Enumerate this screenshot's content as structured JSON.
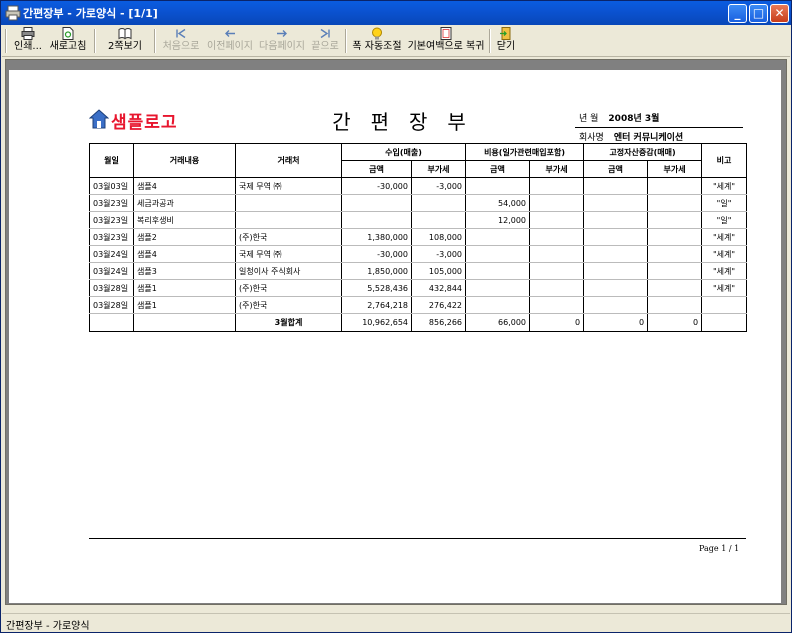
{
  "window": {
    "title": "간편장부 - 가로양식 - [1/1]",
    "min_label": "_",
    "max_label": "□",
    "close_label": "✕"
  },
  "toolbar": {
    "print": "인쇄...",
    "refresh": "새로고침",
    "two_page": "2쪽보기",
    "first": "처음으로",
    "prev": "이전페이지",
    "next": "다음페이지",
    "last": "끝으로",
    "fit_width": "폭 자동조절",
    "reset_margin": "기본여백으로 복귀",
    "close": "닫기"
  },
  "report": {
    "logo": "샘플로고",
    "title": "간편장부",
    "period_label": "년 월",
    "period_value": "2008년 3월",
    "company_label": "회사명",
    "company_value": "엔터 커뮤니케이션",
    "page_label": "Page 1 / 1"
  },
  "table": {
    "headers": {
      "date": "월일",
      "desc": "거래내용",
      "partner": "거래처",
      "revenue": "수입(매출)",
      "expense": "비용(일가관련매입포함)",
      "asset": "고정자산증감(매매)",
      "note": "비고",
      "amount": "금액",
      "vat": "부가세"
    },
    "rows": [
      {
        "date": "03월03일",
        "desc": "샘플4",
        "partner": "국제 무역 ㈜",
        "rev_amt": "-30,000",
        "rev_vat": "-3,000",
        "exp_amt": "",
        "exp_vat": "",
        "ast_amt": "",
        "ast_vat": "",
        "note": "\"세계\""
      },
      {
        "date": "03월23일",
        "desc": "세금과공과",
        "partner": "",
        "rev_amt": "",
        "rev_vat": "",
        "exp_amt": "54,000",
        "exp_vat": "",
        "ast_amt": "",
        "ast_vat": "",
        "note": "\"일\""
      },
      {
        "date": "03월23일",
        "desc": "복리후생비",
        "partner": "",
        "rev_amt": "",
        "rev_vat": "",
        "exp_amt": "12,000",
        "exp_vat": "",
        "ast_amt": "",
        "ast_vat": "",
        "note": "\"일\""
      },
      {
        "date": "03월23일",
        "desc": "샘플2",
        "partner": "(주)한국",
        "rev_amt": "1,380,000",
        "rev_vat": "108,000",
        "exp_amt": "",
        "exp_vat": "",
        "ast_amt": "",
        "ast_vat": "",
        "note": "\"세계\""
      },
      {
        "date": "03월24일",
        "desc": "샘플4",
        "partner": "국제 무역 ㈜",
        "rev_amt": "-30,000",
        "rev_vat": "-3,000",
        "exp_amt": "",
        "exp_vat": "",
        "ast_amt": "",
        "ast_vat": "",
        "note": "\"세계\""
      },
      {
        "date": "03월24일",
        "desc": "샘플3",
        "partner": "일청이사 주식회사",
        "rev_amt": "1,850,000",
        "rev_vat": "105,000",
        "exp_amt": "",
        "exp_vat": "",
        "ast_amt": "",
        "ast_vat": "",
        "note": "\"세계\""
      },
      {
        "date": "03월28일",
        "desc": "샘플1",
        "partner": "(주)한국",
        "rev_amt": "5,528,436",
        "rev_vat": "432,844",
        "exp_amt": "",
        "exp_vat": "",
        "ast_amt": "",
        "ast_vat": "",
        "note": "\"세계\""
      },
      {
        "date": "03월28일",
        "desc": "샘플1",
        "partner": "(주)한국",
        "rev_amt": "2,764,218",
        "rev_vat": "276,422",
        "exp_amt": "",
        "exp_vat": "",
        "ast_amt": "",
        "ast_vat": "",
        "note": ""
      }
    ],
    "total": {
      "label": "3월합계",
      "rev_amt": "10,962,654",
      "rev_vat": "856,266",
      "exp_amt": "66,000",
      "exp_vat": "0",
      "ast_amt": "0",
      "ast_vat": "0"
    }
  },
  "statusbar": {
    "text": "간편장부 - 가로양식"
  },
  "colors": {
    "titlebar": "#0b53d2",
    "logo": "#e8162e"
  }
}
